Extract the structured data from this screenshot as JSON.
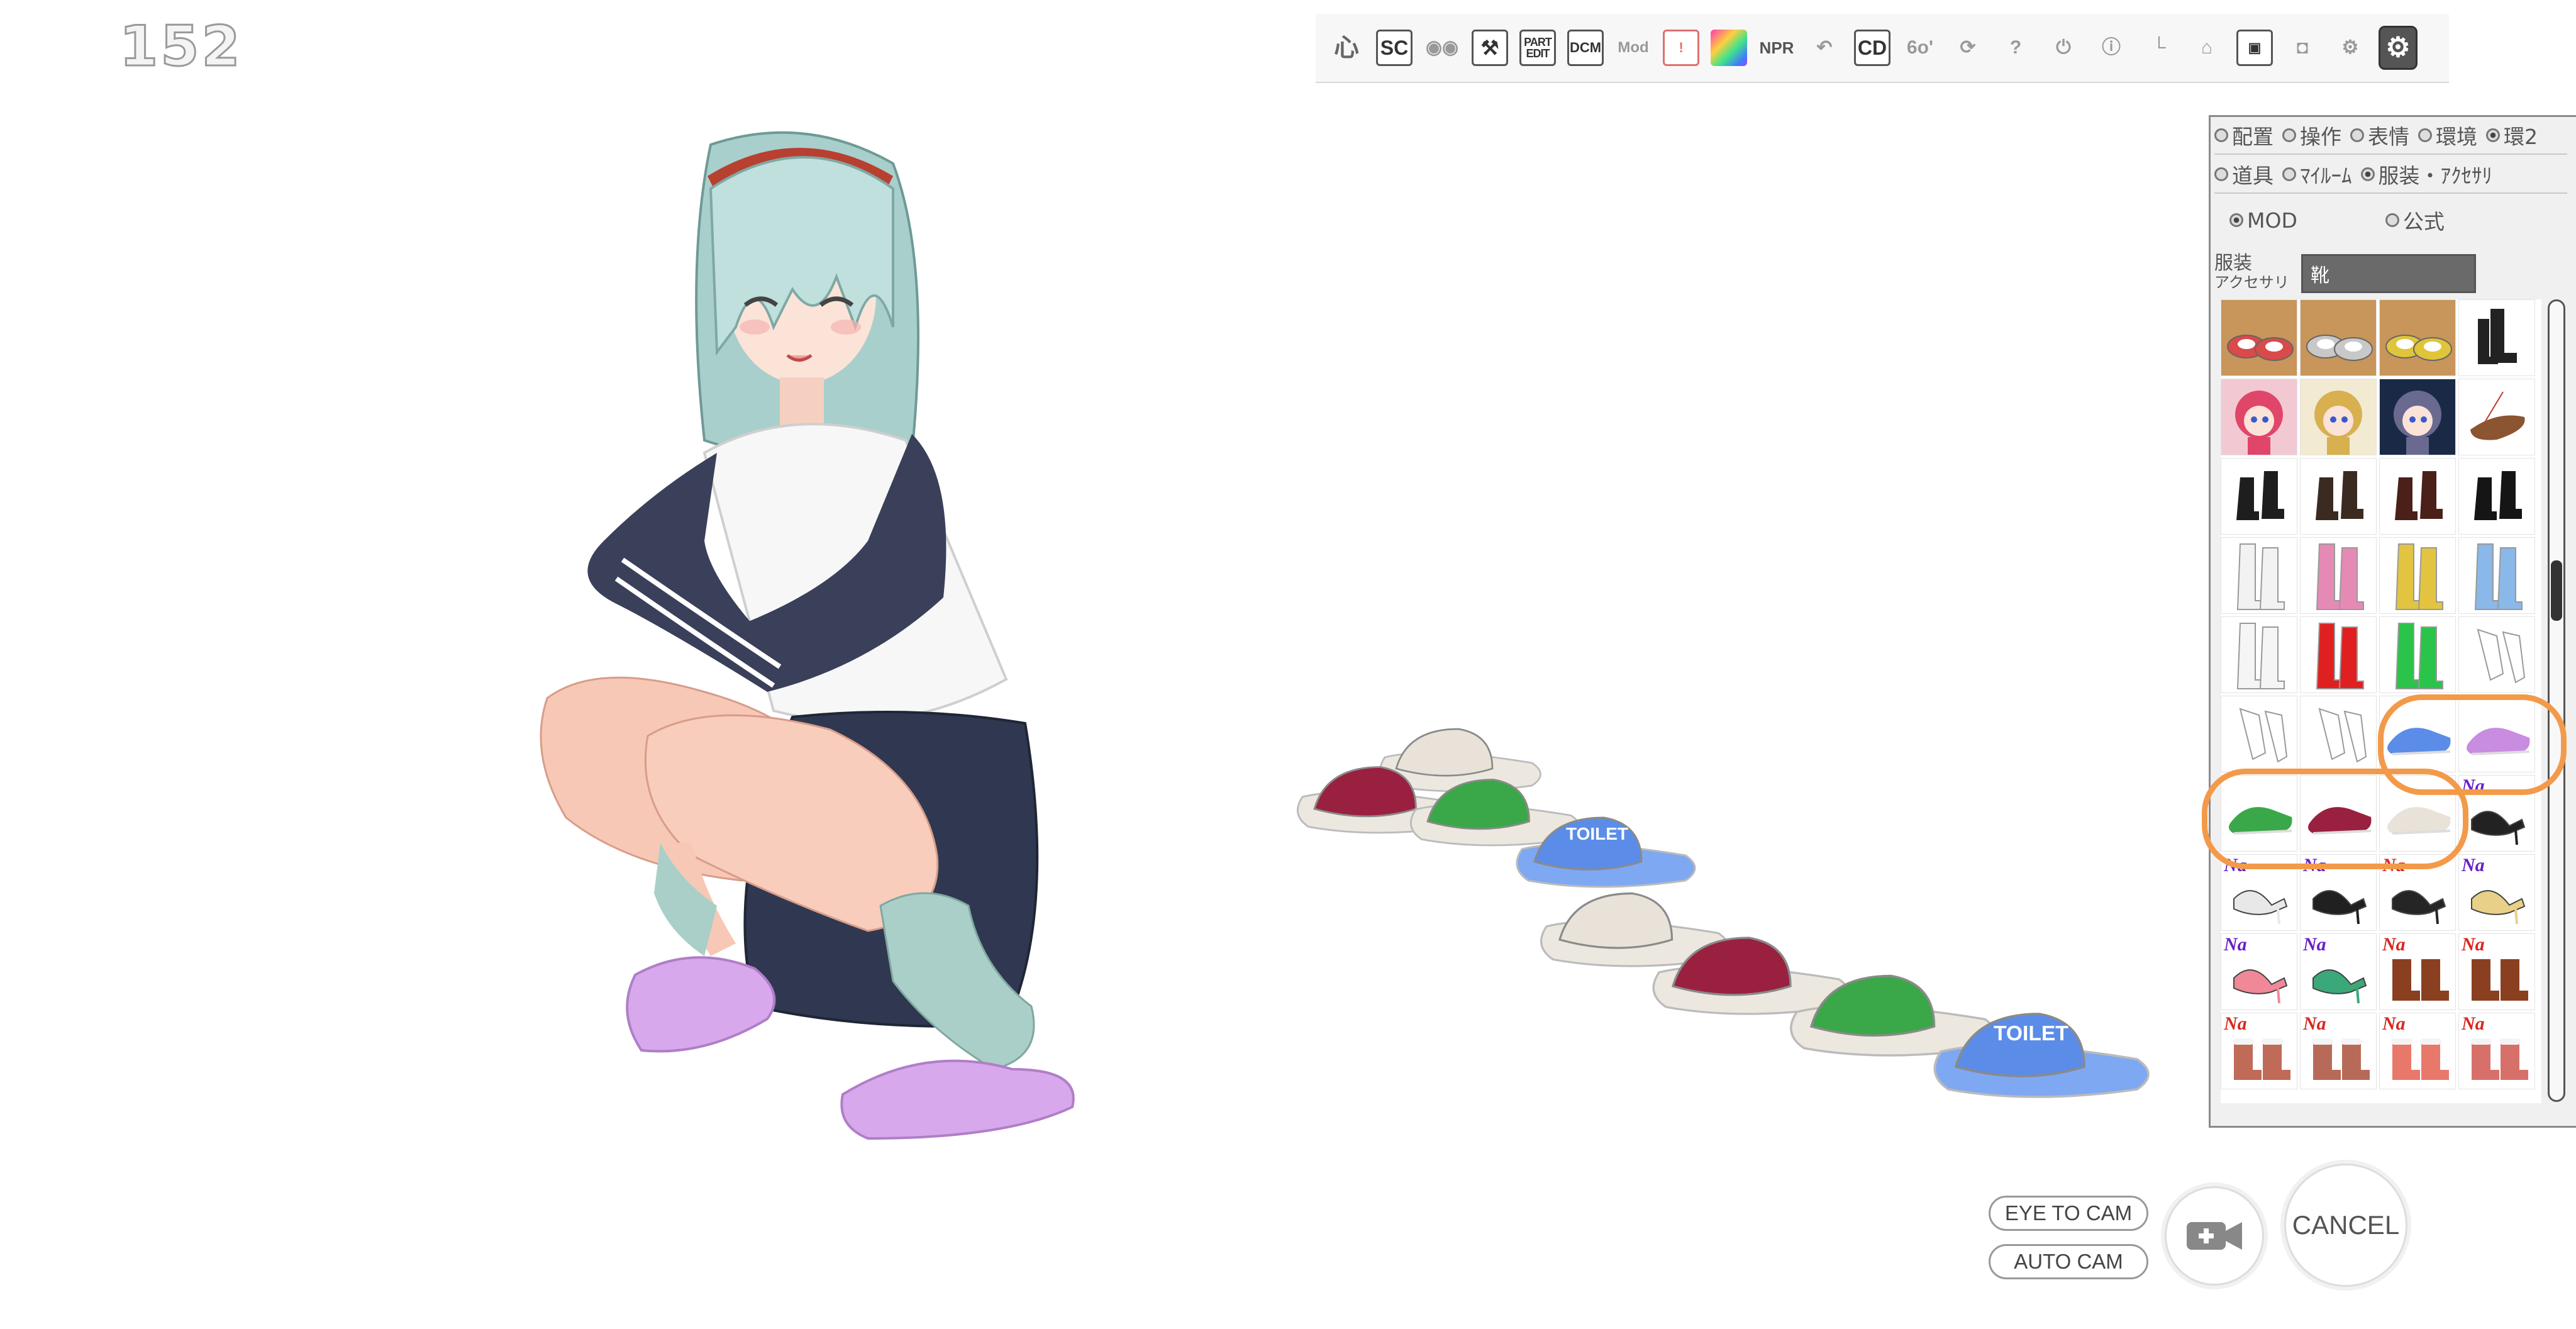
{
  "hud": {
    "frame_counter": "152"
  },
  "toolbar": {
    "buttons": [
      {
        "name": "pose-button",
        "icon": "pose-icon",
        "label": "心",
        "style": "plain"
      },
      {
        "name": "sc-button",
        "icon": "sc-icon",
        "label": "SC",
        "style": "big"
      },
      {
        "name": "eyes-button",
        "icon": "eyes-icon",
        "label": "◉◉",
        "style": "dim"
      },
      {
        "name": "tool-button",
        "icon": "wrench-icon",
        "label": "⚒",
        "style": "big"
      },
      {
        "name": "part-edit-button",
        "icon": "part-edit-icon",
        "label": "PART\nEDIT",
        "style": "small"
      },
      {
        "name": "dcm-button",
        "icon": "dcm-icon",
        "label": "DCM",
        "style": "normal"
      },
      {
        "name": "mod-button",
        "icon": "mod-icon",
        "label": "Mod",
        "style": "dim-text"
      },
      {
        "name": "info-frame-button",
        "icon": "frame-icon",
        "label": "!",
        "style": "red"
      },
      {
        "name": "color-button",
        "icon": "palette-icon",
        "label": "",
        "style": "grad"
      },
      {
        "name": "npr-button",
        "icon": "npr-icon",
        "label": "NPR",
        "style": "text"
      },
      {
        "name": "undo-button",
        "icon": "undo-icon",
        "label": "↶",
        "style": "dim"
      },
      {
        "name": "cd-button",
        "icon": "cd-icon",
        "label": "CD",
        "style": "big"
      },
      {
        "name": "glasses-button",
        "icon": "glasses-icon",
        "label": "6o'",
        "style": "dim"
      },
      {
        "name": "refresh-button",
        "icon": "refresh-icon",
        "label": "⟳",
        "style": "dim"
      },
      {
        "name": "help-button",
        "icon": "help-icon",
        "label": "?",
        "style": "dim"
      },
      {
        "name": "power-button",
        "icon": "power-icon",
        "label": "⏻",
        "style": "dim"
      },
      {
        "name": "info-button",
        "icon": "info-icon",
        "label": "ⓘ",
        "style": "dim"
      },
      {
        "name": "axis-button",
        "icon": "axis-icon",
        "label": "└",
        "style": "dim"
      },
      {
        "name": "shop-button",
        "icon": "basket-icon",
        "label": "⌂",
        "style": "dim"
      },
      {
        "name": "save-button",
        "icon": "save-icon",
        "label": "▣",
        "style": "normal"
      },
      {
        "name": "camera-button",
        "icon": "camera-icon",
        "label": "◘",
        "style": "dim"
      },
      {
        "name": "gears-button",
        "icon": "gears-icon",
        "label": "⚙",
        "style": "dim"
      },
      {
        "name": "settings-button",
        "icon": "settings-icon",
        "label": "⚙",
        "style": "active"
      }
    ]
  },
  "panel": {
    "row1": [
      {
        "label": "配置",
        "checked": false
      },
      {
        "label": "操作",
        "checked": false
      },
      {
        "label": "表情",
        "checked": false
      },
      {
        "label": "環境",
        "checked": false
      },
      {
        "label": "環2",
        "checked": true
      }
    ],
    "row2": [
      {
        "label": "道具",
        "checked": false
      },
      {
        "label": "ﾏｲﾙｰﾑ",
        "checked": false
      },
      {
        "label": "服装・ｱｸｾｻﾘ",
        "checked": true
      }
    ],
    "row3": [
      {
        "label": "MOD",
        "checked": true
      },
      {
        "label": "公式",
        "checked": false
      }
    ],
    "category_label_1": "服装",
    "category_label_2": "アクセサリ",
    "category_value": "靴",
    "grid_columns": 4,
    "items": [
      {
        "kind": "shoe",
        "color": "#d94a4a",
        "bg": "#c8955a"
      },
      {
        "kind": "shoe",
        "color": "#c8c8c8",
        "bg": "#c8955a"
      },
      {
        "kind": "shoe",
        "color": "#e0c43a",
        "bg": "#c8955a"
      },
      {
        "kind": "boot",
        "color": "#222222",
        "bg": "#ffffff"
      },
      {
        "kind": "avatar",
        "color": "#e0456a",
        "bg": "#f2c9d2"
      },
      {
        "kind": "avatar",
        "color": "#d8b050",
        "bg": "#f3ead2"
      },
      {
        "kind": "avatar",
        "color": "#6a6a90",
        "bg": "#1a2a46"
      },
      {
        "kind": "sandal",
        "color": "#8a5530",
        "bg": "#ffffff"
      },
      {
        "kind": "heel-boot",
        "color": "#1e1e1e",
        "bg": "#ffffff"
      },
      {
        "kind": "heel-boot",
        "color": "#3a2a20",
        "bg": "#ffffff"
      },
      {
        "kind": "heel-boot",
        "color": "#4a2018",
        "bg": "#ffffff"
      },
      {
        "kind": "heel-boot",
        "color": "#151515",
        "bg": "#ffffff"
      },
      {
        "kind": "tall-boot",
        "color": "#f2f2f2",
        "bg": "#ffffff"
      },
      {
        "kind": "tall-boot",
        "color": "#e58ab5",
        "bg": "#ffffff"
      },
      {
        "kind": "tall-boot",
        "color": "#e2c440",
        "bg": "#ffffff"
      },
      {
        "kind": "tall-boot",
        "color": "#8ab8e8",
        "bg": "#ffffff"
      },
      {
        "kind": "tall-boot",
        "color": "#f5f5f5",
        "bg": "#ffffff"
      },
      {
        "kind": "tall-boot",
        "color": "#e02020",
        "bg": "#ffffff"
      },
      {
        "kind": "tall-boot",
        "color": "#2ac44a",
        "bg": "#ffffff"
      },
      {
        "kind": "sketch",
        "color": "#9a9a9a",
        "bg": "#ffffff"
      },
      {
        "kind": "sketch",
        "color": "#9a9a9a",
        "bg": "#ffffff"
      },
      {
        "kind": "sketch",
        "color": "#9a9a9a",
        "bg": "#ffffff"
      },
      {
        "kind": "slipper",
        "color": "#5b8de8",
        "bg": "#ffffff"
      },
      {
        "kind": "slipper",
        "color": "#c88ce0",
        "bg": "#ffffff"
      },
      {
        "kind": "slipper",
        "color": "#3aa848",
        "bg": "#ffffff"
      },
      {
        "kind": "slipper",
        "color": "#9a2040",
        "bg": "#ffffff"
      },
      {
        "kind": "slipper",
        "color": "#e8e2d8",
        "bg": "#ffffff"
      },
      {
        "kind": "heel",
        "color": "#222222",
        "bg": "#ffffff",
        "na": "#6a20c8"
      },
      {
        "kind": "heel",
        "color": "#e8e8e8",
        "bg": "#ffffff",
        "na": "#6a20c8"
      },
      {
        "kind": "heel",
        "color": "#202020",
        "bg": "#ffffff",
        "na": "#6a20c8"
      },
      {
        "kind": "heel",
        "color": "#252525",
        "bg": "#ffffff",
        "na": "#d8281e"
      },
      {
        "kind": "heel",
        "color": "#e8d088",
        "bg": "#ffffff",
        "na": "#6a20c8"
      },
      {
        "kind": "heel",
        "color": "#f08898",
        "bg": "#ffffff",
        "na": "#6a20c8"
      },
      {
        "kind": "heel",
        "color": "#3aa878",
        "bg": "#ffffff",
        "na": "#6a20c8"
      },
      {
        "kind": "ankle-boot",
        "color": "#8a4020",
        "bg": "#ffffff",
        "na": "#d8281e"
      },
      {
        "kind": "ankle-boot",
        "color": "#8a4020",
        "bg": "#ffffff",
        "na": "#d8281e"
      },
      {
        "kind": "fur-boot",
        "color": "#c06a58",
        "bg": "#ffffff",
        "na": "#d8281e"
      },
      {
        "kind": "fur-boot",
        "color": "#b86a58",
        "bg": "#ffffff",
        "na": "#d8281e"
      },
      {
        "kind": "fur-boot",
        "color": "#e8786a",
        "bg": "#ffffff",
        "na": "#d8281e"
      },
      {
        "kind": "fur-boot",
        "color": "#d8706a",
        "bg": "#ffffff",
        "na": "#d8281e"
      }
    ],
    "na_text": "Na"
  },
  "bottom": {
    "eye_to_cam": "EYE TO CAM",
    "auto_cam": "AUTO CAM",
    "cancel": "CANCEL",
    "add_camera_icon": "video-camera-plus-icon"
  },
  "scene": {
    "slipper_colors": [
      "#e8e2d8",
      "#9a2040",
      "#3aa848",
      "#5b8de8",
      "#e8e2d8",
      "#9a2040",
      "#3aa848",
      "#5b8de8"
    ],
    "slipper_text": "TOILET"
  }
}
